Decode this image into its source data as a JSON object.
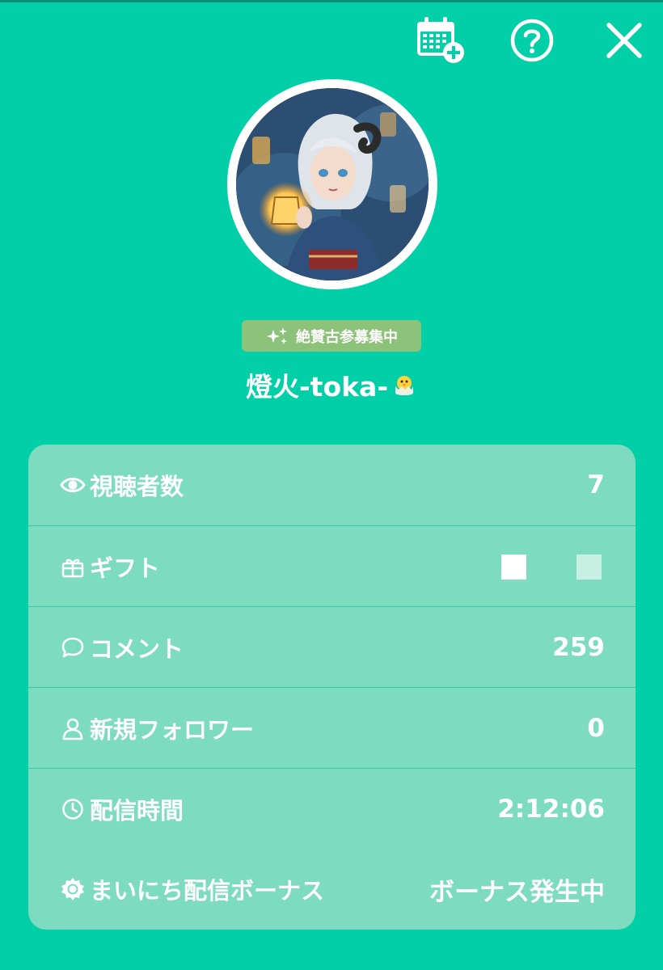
{
  "profile": {
    "badge_text": "絶賛古参募集中",
    "username": "燈火-toka-"
  },
  "stats": [
    {
      "label": "視聴者数",
      "value": "7",
      "icon": "eye-icon"
    },
    {
      "label": "ギフト",
      "value": "",
      "icon": "gift-icon"
    },
    {
      "label": "コメント",
      "value": "259",
      "icon": "comment-icon"
    },
    {
      "label": "新規フォロワー",
      "value": "0",
      "icon": "person-icon"
    },
    {
      "label": "配信時間",
      "value": "2:12:06",
      "icon": "clock-icon"
    },
    {
      "label": "まいにち配信ボーナス",
      "value": "ボーナス発生中",
      "icon": "sun-badge-icon"
    }
  ],
  "colors": {
    "background": "#00CFA8",
    "panel": "#7DDBBF",
    "badge": "#8DC27A"
  }
}
